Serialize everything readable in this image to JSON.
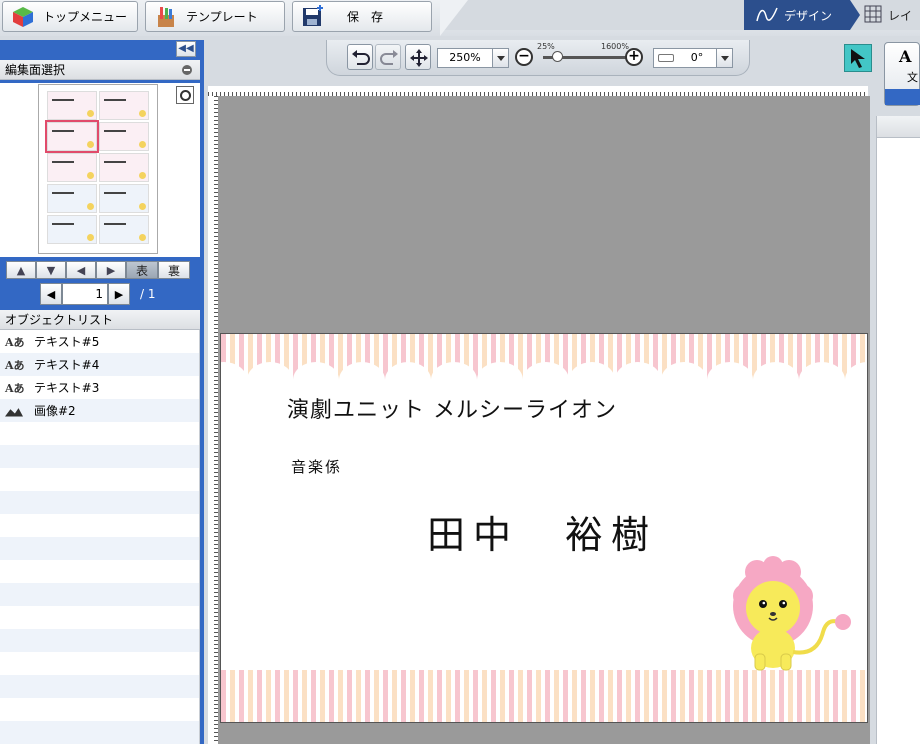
{
  "toolbar": {
    "top_menu": "トップメニュー",
    "template": "テンプレート",
    "save": "保　存"
  },
  "mode_tabs": {
    "design": "デザイン",
    "layout": "レイ"
  },
  "left_panel": {
    "edit_face_title": "編集面選択",
    "face_front": "表",
    "face_back": "裏",
    "page_current": "1",
    "page_total": "/ 1",
    "object_list_title": "オブジェクトリスト",
    "objects": [
      {
        "icon": "text-icon",
        "label": "テキスト#5"
      },
      {
        "icon": "text-icon",
        "label": "テキスト#4"
      },
      {
        "icon": "text-icon",
        "label": "テキスト#3"
      },
      {
        "icon": "image-icon",
        "label": "画像#2"
      }
    ]
  },
  "canvas_toolbar": {
    "zoom_value": "250%",
    "zoom_min_label": "25%",
    "zoom_max_label": "1600%",
    "zoom_level_percent": 250,
    "rotation_value": "0°"
  },
  "right_panel": {
    "text_button_label": "文"
  },
  "card": {
    "company": "演劇ユニット メルシーライオン",
    "role": "音楽係",
    "name": "田中　裕樹"
  },
  "colors": {
    "accent_blue": "#3368c4",
    "design_tab": "#2c4f8d",
    "stripe_pink": "#f7c6cf",
    "stripe_orange": "#fbe0c4",
    "pointer_tool": "#43c6c6"
  }
}
